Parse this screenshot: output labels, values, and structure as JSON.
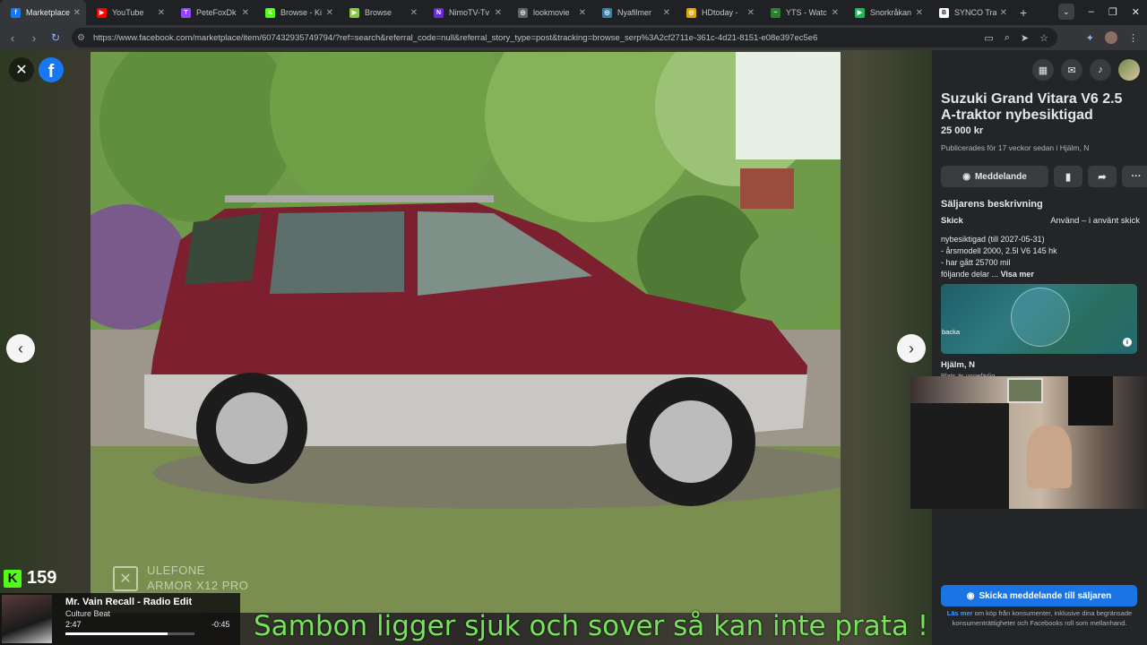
{
  "browser": {
    "tabs": [
      {
        "label": "Marketplace",
        "icon": "facebook-icon",
        "color": "#1877f2",
        "glyph": "f",
        "active": true
      },
      {
        "label": "YouTube",
        "icon": "youtube-icon",
        "color": "#ff0000",
        "glyph": "▶",
        "active": false
      },
      {
        "label": "PeteFoxDk",
        "icon": "twitch-icon",
        "color": "#9146ff",
        "glyph": "T",
        "active": false
      },
      {
        "label": "Browse - Ki",
        "icon": "kick-icon",
        "color": "#53fc18",
        "glyph": "K",
        "active": false
      },
      {
        "label": "Browse",
        "icon": "rumble-icon",
        "color": "#85c742",
        "glyph": "▶",
        "active": false
      },
      {
        "label": "NimoTV-Tv",
        "icon": "nimo-icon",
        "color": "#6a2bd9",
        "glyph": "N",
        "active": false
      },
      {
        "label": "lookmovie",
        "icon": "lookmovie-icon",
        "color": "#5f6368",
        "glyph": "◎",
        "active": false
      },
      {
        "label": "Nyafilmer",
        "icon": "nyafilmer-icon",
        "color": "#3c7ea6",
        "glyph": "◎",
        "active": false
      },
      {
        "label": "HDtoday -",
        "icon": "hdtoday-icon",
        "color": "#e0a800",
        "glyph": "◎",
        "active": false
      },
      {
        "label": "YTS - Watc",
        "icon": "yts-icon",
        "color": "#2e7d32",
        "glyph": "~",
        "active": false
      },
      {
        "label": "Snorkråkan",
        "icon": "play-icon",
        "color": "#1db954",
        "glyph": "▶",
        "active": false
      },
      {
        "label": "SYNCO Trai",
        "icon": "synco-icon",
        "color": "#ffffff",
        "glyph": "B",
        "active": false
      }
    ],
    "new_tab": "+",
    "url": "https://www.facebook.com/marketplace/item/607432935749794/?ref=search&referral_code=null&referral_story_type=post&tracking=browse_serp%3A2cf2711e-361c-4d21-8151-e08e397ec5e6"
  },
  "viewer": {
    "watermark_line1": "ULEFONE",
    "watermark_line2": "ARMOR X12 PRO"
  },
  "stream": {
    "kick_count": "159",
    "song_title": "Mr. Vain Recall - Radio Edit",
    "song_artist": "Culture Beat",
    "elapsed": "2:47",
    "remaining": "-0:45",
    "progress": 0.79,
    "subtitle": "Sambon ligger sjuk och sover så kan inte prata !"
  },
  "listing": {
    "title": "Suzuki Grand Vitara V6 2.5 A-traktor nybesiktigad",
    "price": "25 000 kr",
    "published": "Publicerades för 17 veckor sedan i Hjälm, N",
    "message_label": "Meddelande",
    "section_title": "Säljarens beskrivning",
    "condition_label": "Skick",
    "condition_value": "Använd – i använt skick",
    "desc_line1": "nybesiktigad (till 2027-05-31)",
    "desc_line2": "- årsmodell 2000, 2.5l V6 145 hk",
    "desc_line3": "- har gått 25700 mil",
    "desc_line4": "följande delar ...",
    "see_more": "Visa mer",
    "map_label": "backa",
    "location": "Hjälm, N",
    "location_sub": "Plats är ungefärlig",
    "send_label": "Skicka meddelande till säljaren",
    "disclaimer_link": "Läs mer",
    "disclaimer_text": "om köp från konsumenter, inklusive dina begränsade konsumenträttigheter och Facebooks roll som mellanhand."
  },
  "colors": {
    "facebook_blue": "#1877f2",
    "send_button": "#1b74e4",
    "kick_green": "#53fc18",
    "subtitle_green": "#76e35a"
  }
}
